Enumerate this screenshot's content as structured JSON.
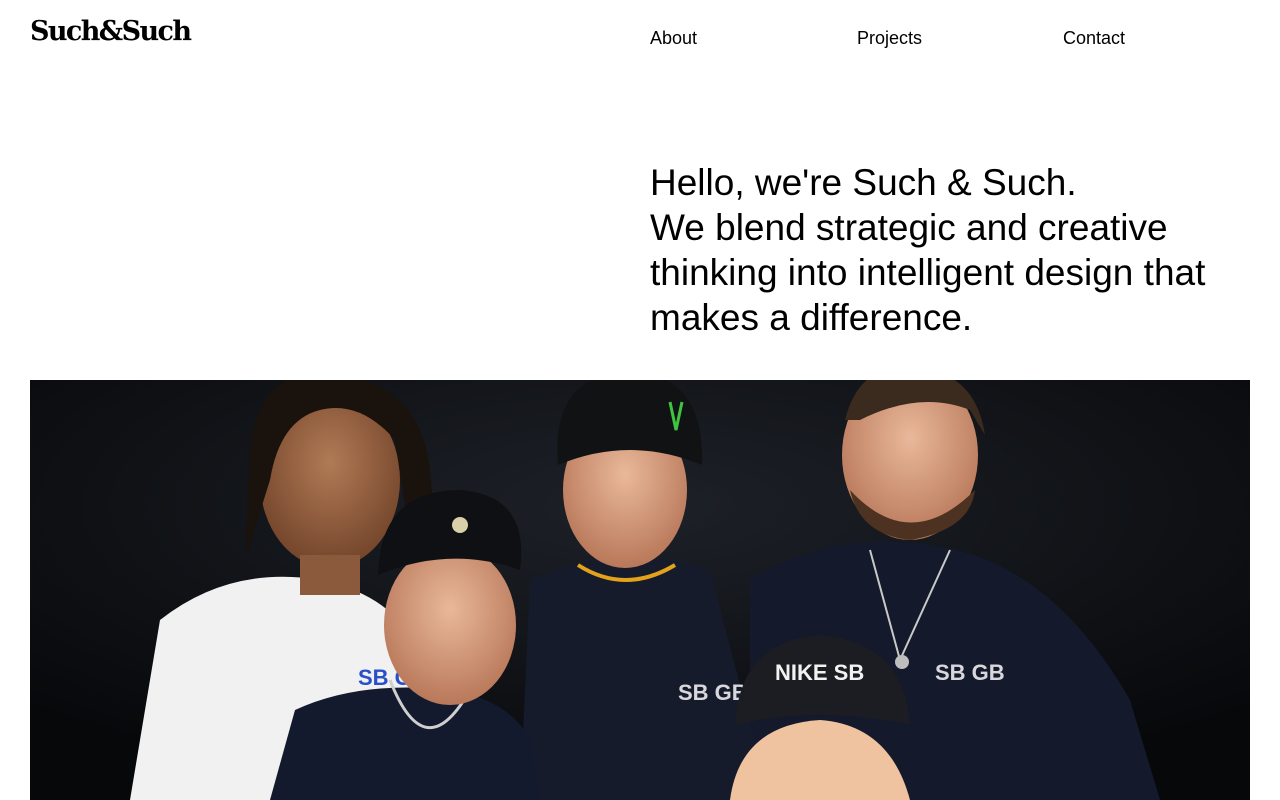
{
  "header": {
    "logo": "Such&Such",
    "nav": [
      {
        "label": "About"
      },
      {
        "label": "Projects"
      },
      {
        "label": "Contact"
      }
    ]
  },
  "intro": {
    "line1": "Hello, we're Such & Such.",
    "line2": "We blend strategic and creative thinking into intelligent design that makes a difference."
  },
  "hero": {
    "shirt_logo": "SB GB",
    "cap_logo": "NIKE SB",
    "colors": {
      "background": "#0b0d10",
      "white_shirt": "#f2f2f2",
      "navy_shirt": "#14192b",
      "logo_blue": "#2a4fc8"
    }
  }
}
